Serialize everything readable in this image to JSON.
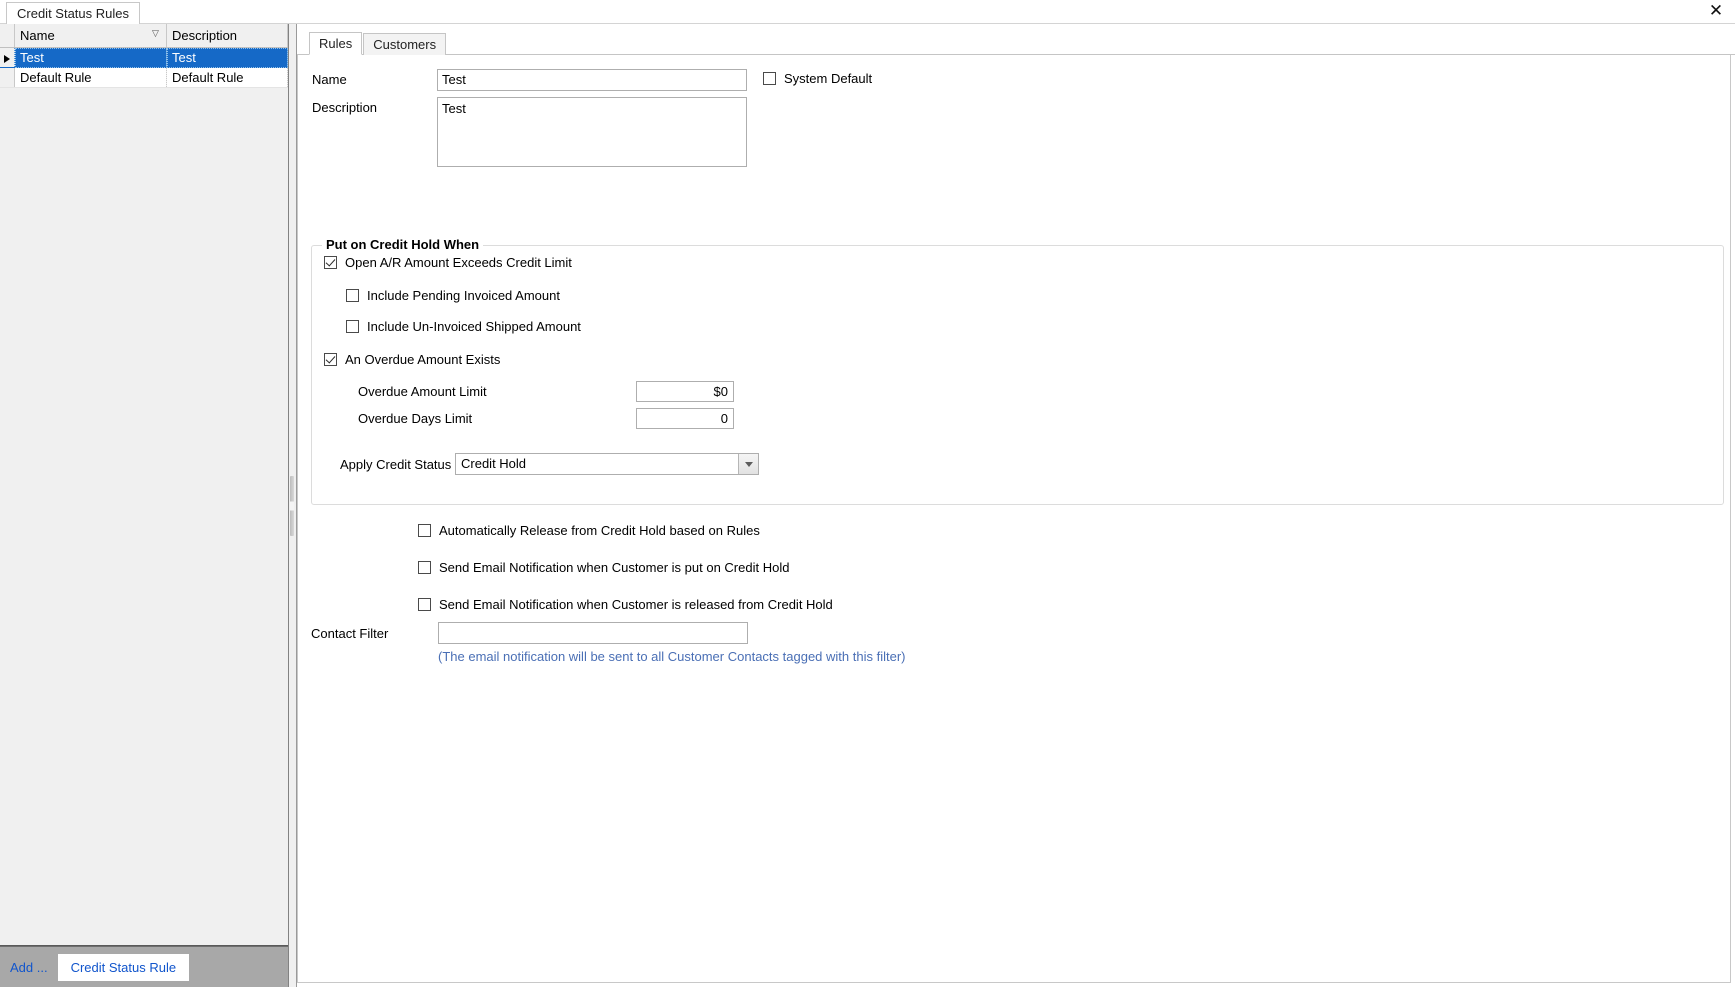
{
  "window": {
    "doc_tab_label": "Credit Status Rules",
    "close_icon": "close-icon"
  },
  "left_panel": {
    "columns": [
      "Name",
      "Description"
    ],
    "sort_indicator_column": "Name",
    "sort_glyph": "▽",
    "rows": [
      {
        "name": "Test",
        "description": "Test",
        "selected": true
      },
      {
        "name": "Default Rule",
        "description": "Default Rule",
        "selected": false
      }
    ],
    "footer": {
      "add_label": "Add ...",
      "add_target_label": "Credit Status Rule"
    }
  },
  "right_panel": {
    "tabs": [
      {
        "label": "Rules",
        "active": true
      },
      {
        "label": "Customers",
        "active": false
      }
    ],
    "fields": {
      "name_label": "Name",
      "name_value": "Test",
      "description_label": "Description",
      "description_value": "Test",
      "system_default_label": "System Default",
      "system_default_checked": false
    },
    "group": {
      "title": "Put on Credit Hold When",
      "open_ar_label": "Open A/R Amount Exceeds Credit Limit",
      "open_ar_checked": true,
      "include_pending_label": "Include Pending Invoiced Amount",
      "include_pending_checked": false,
      "include_uninvoiced_label": "Include Un-Invoiced Shipped Amount",
      "include_uninvoiced_checked": false,
      "overdue_exists_label": "An Overdue Amount Exists",
      "overdue_exists_checked": true,
      "overdue_amount_label": "Overdue Amount Limit",
      "overdue_amount_value": "$0",
      "overdue_days_label": "Overdue Days Limit",
      "overdue_days_value": "0",
      "apply_status_label": "Apply Credit Status",
      "apply_status_value": "Credit Hold",
      "apply_status_dropdown_icon": "chevron-down-icon"
    },
    "options": {
      "auto_release_label": "Automatically Release from Credit Hold based on Rules",
      "auto_release_checked": false,
      "email_on_hold_label": "Send Email Notification when Customer is put on Credit Hold",
      "email_on_hold_checked": false,
      "email_on_release_label": "Send Email Notification when Customer is released from Credit Hold",
      "email_on_release_checked": false
    },
    "contact_filter": {
      "label": "Contact Filter",
      "value": "",
      "placeholder": "",
      "hint": "(The email notification will be sent to all Customer Contacts tagged with this filter)"
    }
  },
  "colors": {
    "selection_blue": "#1569c7",
    "link_blue": "#1155cc",
    "hint_blue": "#4a6fb5",
    "footer_gray": "#a8a8a8"
  }
}
